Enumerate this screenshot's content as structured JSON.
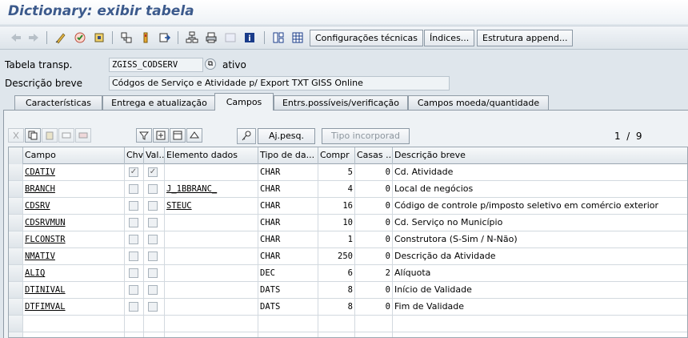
{
  "window": {
    "title": "Dictionary: exibir tabela"
  },
  "toolbar": {
    "buttons": [
      "Configurações técnicas",
      "Índices...",
      "Estrutura append..."
    ]
  },
  "header": {
    "table_label": "Tabela transp.",
    "table_value": "ZGISS_CODSERV",
    "status": "ativo",
    "desc_label": "Descrição breve",
    "desc_value": "Códgos de Serviço e Atividade p/ Export TXT GISS Online"
  },
  "tabs": [
    "Características",
    "Entrega e atualização",
    "Campos",
    "Entrs.possíveis/verificação",
    "Campos moeda/quantidade"
  ],
  "active_tab": "Campos",
  "panel": {
    "search_help_button": "Aj.pesq.",
    "built_in_type_button": "Tipo incorporad",
    "pager": "1  /  9"
  },
  "grid": {
    "headers": [
      "Campo",
      "Chv",
      "Val...",
      "Elemento dados",
      "Tipo de da...",
      "Compr",
      "Casas ...",
      "Descrição breve"
    ],
    "rows": [
      {
        "campo": "CDATIV",
        "chv": "✓",
        "val": "✓",
        "elemento": "",
        "tipo": "CHAR",
        "compr": "5",
        "casas": "0",
        "descricao": "Cd. Atividade"
      },
      {
        "campo": "BRANCH",
        "chv": "",
        "val": "",
        "elemento": "J_1BBRANC_",
        "tipo": "CHAR",
        "compr": "4",
        "casas": "0",
        "descricao": "Local de negócios"
      },
      {
        "campo": "CDSRV",
        "chv": "",
        "val": "",
        "elemento": "STEUC",
        "tipo": "CHAR",
        "compr": "16",
        "casas": "0",
        "descricao": "Código de controle p/imposto seletivo em comércio exterior"
      },
      {
        "campo": "CDSRVMUN",
        "chv": "",
        "val": "",
        "elemento": "",
        "tipo": "CHAR",
        "compr": "10",
        "casas": "0",
        "descricao": "Cd. Serviço no Município"
      },
      {
        "campo": "FLCONSTR",
        "chv": "",
        "val": "",
        "elemento": "",
        "tipo": "CHAR",
        "compr": "1",
        "casas": "0",
        "descricao": "Construtora (S-Sim / N-Não)"
      },
      {
        "campo": "NMATIV",
        "chv": "",
        "val": "",
        "elemento": "",
        "tipo": "CHAR",
        "compr": "250",
        "casas": "0",
        "descricao": "Descrição da Atividade"
      },
      {
        "campo": "ALIQ",
        "chv": "",
        "val": "",
        "elemento": "",
        "tipo": "DEC",
        "compr": "6",
        "casas": "2",
        "descricao": "Alíquota"
      },
      {
        "campo": "DTINIVAL",
        "chv": "",
        "val": "",
        "elemento": "",
        "tipo": "DATS",
        "compr": "8",
        "casas": "0",
        "descricao": "Início de Validade"
      },
      {
        "campo": "DTFIMVAL",
        "chv": "",
        "val": "",
        "elemento": "",
        "tipo": "DATS",
        "compr": "8",
        "casas": "0",
        "descricao": "Fim de Validade"
      }
    ]
  }
}
